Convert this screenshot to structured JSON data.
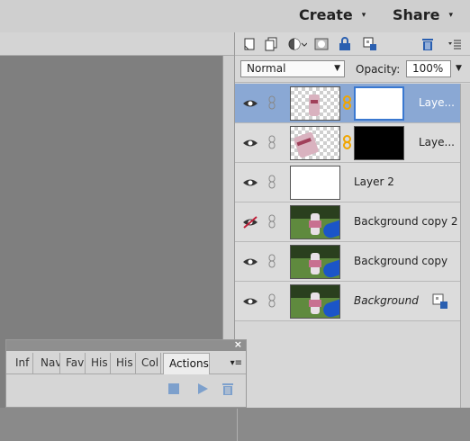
{
  "header": {
    "create_label": "Create",
    "share_label": "Share",
    "caret": "▾"
  },
  "layers_panel": {
    "toolbar_icons": [
      "new-layer-icon",
      "duplicate-layer-icon",
      "adjustment-layer-icon",
      "layer-mask-icon",
      "lock-transparent-icon",
      "lock-all-icon",
      "trash-icon",
      "panel-menu-icon"
    ],
    "blend_mode": "Normal",
    "opacity_label": "Opacity:",
    "opacity_value": "100%",
    "layers": [
      {
        "name": "Laye...",
        "thumb": "checker-kid",
        "mask": "white",
        "selected": true,
        "visible": true
      },
      {
        "name": "Laye...",
        "thumb": "checker-kid2",
        "mask": "black",
        "selected": false,
        "visible": true
      },
      {
        "name": "Layer 2",
        "thumb": "white",
        "selected": false,
        "visible": true
      },
      {
        "name": "Background copy 2",
        "thumb": "photo",
        "selected": false,
        "visible": false
      },
      {
        "name": "Background copy",
        "thumb": "photo",
        "selected": false,
        "visible": true
      },
      {
        "name": "Background",
        "thumb": "photo",
        "selected": false,
        "visible": true,
        "locked": true
      }
    ]
  },
  "floating_panel": {
    "close_label": "×",
    "tabs": [
      "Inf",
      "Nav",
      "Fav",
      "His",
      "His",
      "Col",
      "Actions"
    ],
    "active_tab": "Actions",
    "menu_glyph": "▾≡"
  },
  "colors": {
    "selected_layer_bg": "#8aa8d4",
    "mask_selection_border": "#3a78d0",
    "link_icon_color": "#f0a500"
  }
}
